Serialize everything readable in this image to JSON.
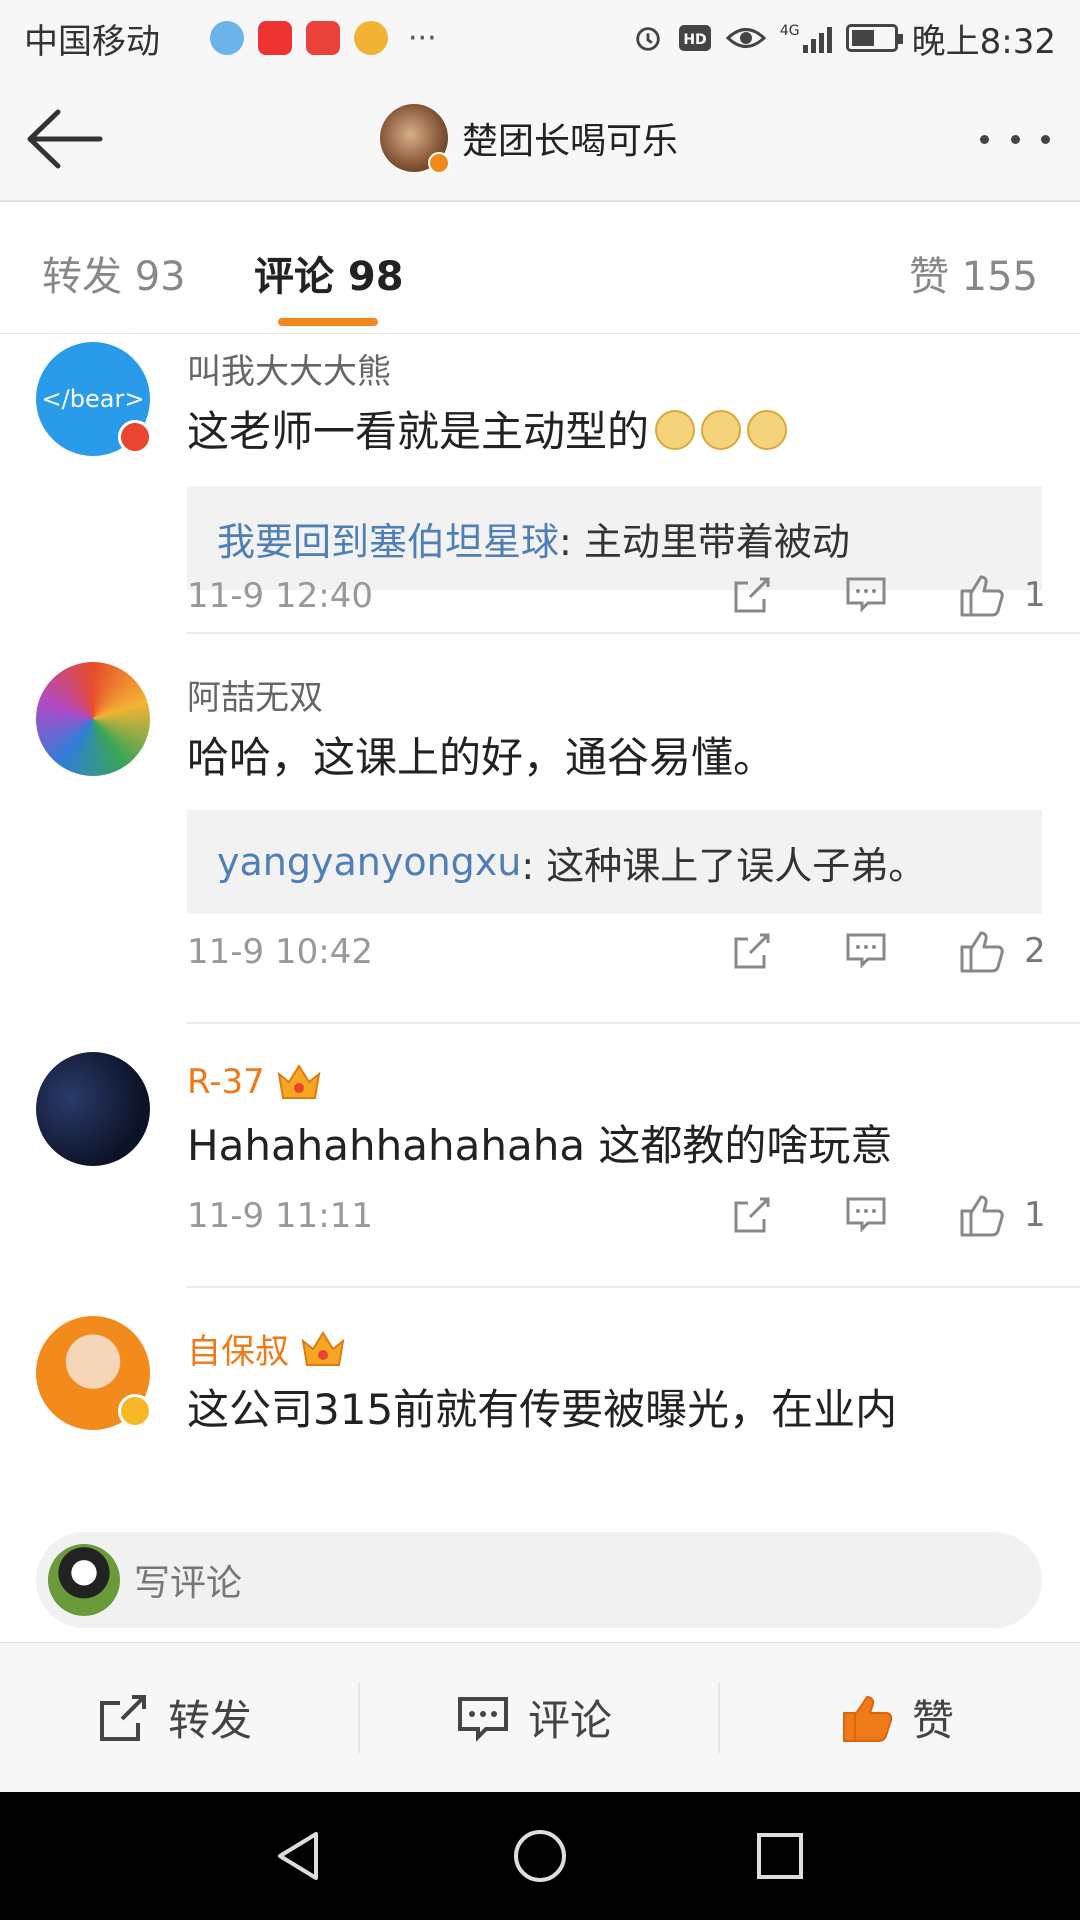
{
  "status_bar": {
    "carrier": "中国移动",
    "dots": "···",
    "network": "4G",
    "time": "晚上8:32",
    "app_icons": [
      "qq-browser-icon",
      "sina-icon",
      "securities-icon",
      "weibo-icon"
    ]
  },
  "nav": {
    "title": "楚团长喝可乐"
  },
  "tabs": {
    "repost": "转发 93",
    "comment": "评论 98",
    "like": "赞 155",
    "accent": "#f08a1c"
  },
  "comments": [
    {
      "username": "叫我大大大熊",
      "avatar_text": "</bear>",
      "text": "这老师一看就是主动型的",
      "reply_user": "我要回到塞伯坦星球",
      "reply_text": ": 主动里带着被动",
      "time": "11-9 12:40",
      "likes": "1"
    },
    {
      "username": "阿喆无双",
      "text": "哈哈，这课上的好，通谷易懂。",
      "reply_user": "yangyanyongxu",
      "reply_text": ": 这种课上了误人子弟。",
      "time": "11-9 10:42",
      "likes": "2"
    },
    {
      "username": "R-37",
      "text": "Hahahahhahahaha 这都教的啥玩意",
      "time": "11-9 11:11",
      "likes": "1"
    },
    {
      "username": "自保叔",
      "text": "这公司315前就有传要被曝光，在业内"
    }
  ],
  "write_comment": {
    "placeholder": "写评论"
  },
  "bottom_bar": {
    "repost": "转发",
    "comment": "评论",
    "like": "赞",
    "like_color": "#f07a1a"
  }
}
